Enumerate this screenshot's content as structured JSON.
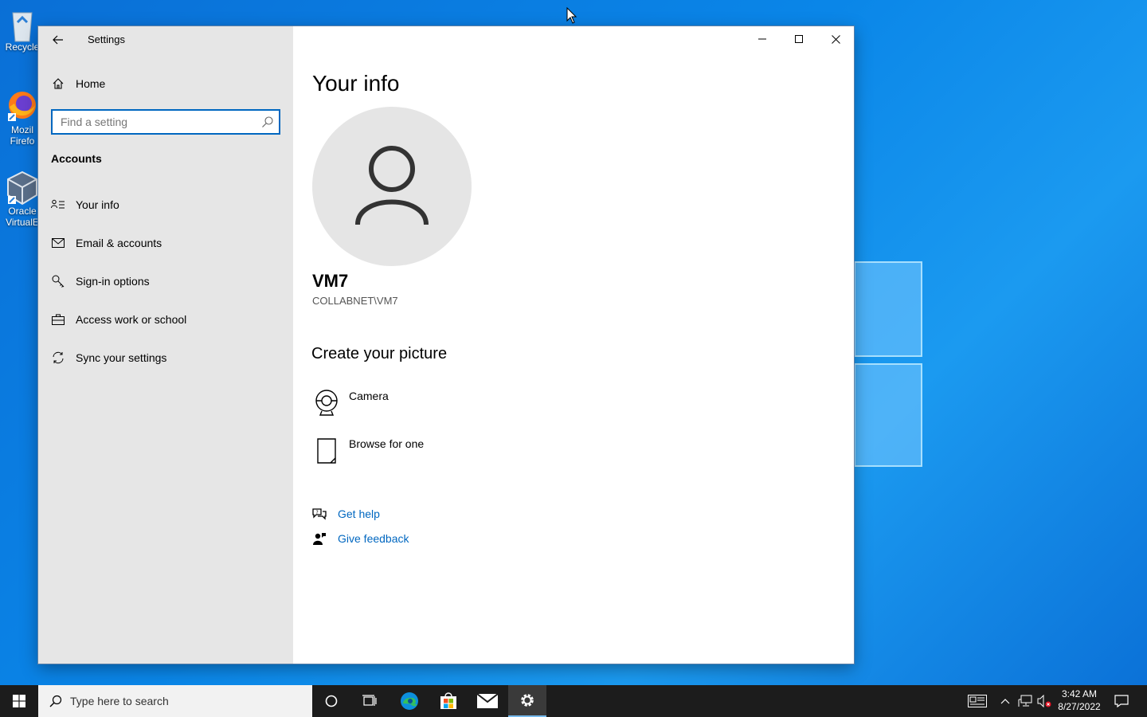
{
  "desktop": {
    "icons": [
      {
        "label": "Recycle"
      },
      {
        "label": "Mozil Firefo"
      },
      {
        "label": "Oracle VirtualE"
      }
    ]
  },
  "window": {
    "title": "Settings",
    "sidebar": {
      "home_label": "Home",
      "search_placeholder": "Find a setting",
      "section": "Accounts",
      "items": [
        {
          "label": "Your info",
          "icon": "contact-info-icon"
        },
        {
          "label": "Email & accounts",
          "icon": "mail-icon"
        },
        {
          "label": "Sign-in options",
          "icon": "key-icon"
        },
        {
          "label": "Access work or school",
          "icon": "briefcase-icon"
        },
        {
          "label": "Sync your settings",
          "icon": "sync-icon"
        }
      ]
    },
    "main": {
      "heading": "Your info",
      "user_name": "VM7",
      "user_domain": "COLLABNET\\VM7",
      "create_heading": "Create your picture",
      "picture_options": [
        {
          "label": "Camera"
        },
        {
          "label": "Browse for one"
        }
      ],
      "links": [
        {
          "label": "Get help"
        },
        {
          "label": "Give feedback"
        }
      ]
    }
  },
  "taskbar": {
    "search_placeholder": "Type here to search",
    "time": "3:42 AM",
    "date": "8/27/2022"
  },
  "colors": {
    "accent": "#0067c0",
    "sidebar_bg": "#e6e6e6",
    "taskbar_bg": "#1c1c1c"
  }
}
